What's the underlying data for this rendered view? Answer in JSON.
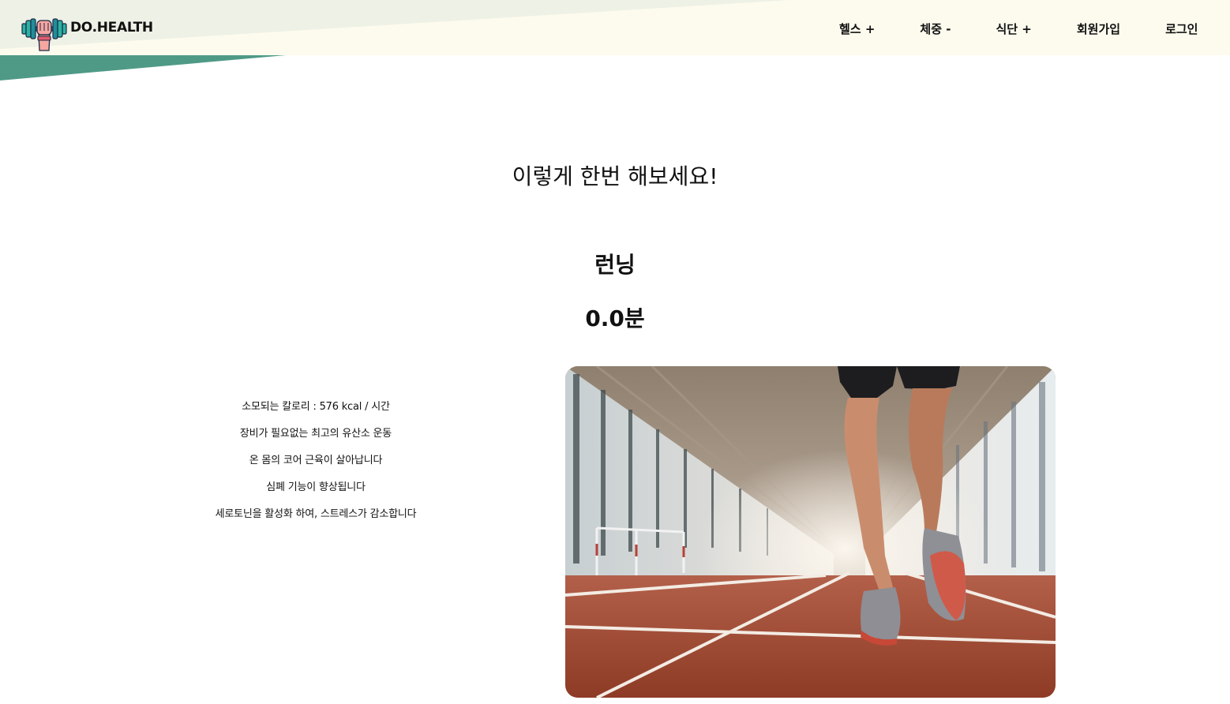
{
  "header": {
    "brand": "DO.HEALTH",
    "logo_icon": "dumbbell-fist-icon",
    "nav": [
      {
        "label": "헬스 +"
      },
      {
        "label": "체중 -"
      },
      {
        "label": "식단 +"
      },
      {
        "label": "회원가입"
      },
      {
        "label": "로그인"
      }
    ]
  },
  "main": {
    "headline": "이렇게 한번 해보세요!",
    "exercise_name": "런닝",
    "duration": "0.0분",
    "info": [
      "소모되는 칼로리 : 576 kcal / 시간",
      "장비가 필요없는 최고의 유산소 운동",
      "온 몸의 코어 근육이 살아납니다",
      "심폐 기능이 향상됩니다",
      "세로토닌을 활성화 하여, 스트레스가 감소합니다"
    ]
  },
  "colors": {
    "header_cream": "#fdfbee",
    "header_stripe": "#eef1e6",
    "header_teal": "#4f9a87",
    "track": "#a84a32"
  }
}
